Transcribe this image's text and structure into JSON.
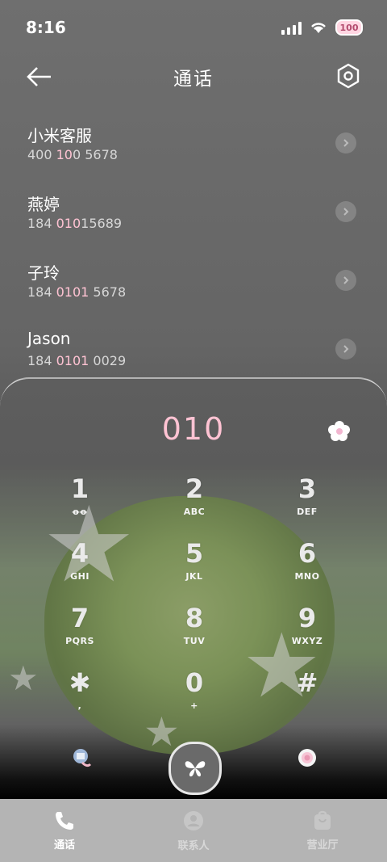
{
  "status_bar": {
    "time": "8:16",
    "battery": "100"
  },
  "header": {
    "title": "通话"
  },
  "recents": [
    {
      "name": "小米客服",
      "number_parts": [
        "400 ",
        "10",
        "0 5678"
      ]
    },
    {
      "name": "燕婷",
      "number_parts": [
        "184 ",
        "010",
        "15689"
      ]
    },
    {
      "name": "子玲",
      "number_parts": [
        "184 ",
        "0101",
        " 5678"
      ]
    },
    {
      "name": "Jason",
      "number_parts": [
        "184 ",
        "0101",
        " 0029"
      ]
    }
  ],
  "dialer": {
    "input": "010",
    "keys": [
      {
        "digit": "1",
        "letters": "ꝋꝋ"
      },
      {
        "digit": "2",
        "letters": "ABC"
      },
      {
        "digit": "3",
        "letters": "DEF"
      },
      {
        "digit": "4",
        "letters": "GHI"
      },
      {
        "digit": "5",
        "letters": "JKL"
      },
      {
        "digit": "6",
        "letters": "MNO"
      },
      {
        "digit": "7",
        "letters": "PQRS"
      },
      {
        "digit": "8",
        "letters": "TUV"
      },
      {
        "digit": "9",
        "letters": "WXYZ"
      },
      {
        "digit": "✱",
        "letters": ","
      },
      {
        "digit": "0",
        "letters": "+"
      },
      {
        "digit": "#",
        "letters": ""
      }
    ]
  },
  "tabs": [
    {
      "label": "通话",
      "icon": "phone-icon",
      "active": true
    },
    {
      "label": "联系人",
      "icon": "contact-icon",
      "active": false
    },
    {
      "label": "营业厅",
      "icon": "store-icon",
      "active": false
    }
  ],
  "colors": {
    "accent": "#ffc3d3",
    "tab_bar": "#b4b4b4"
  }
}
